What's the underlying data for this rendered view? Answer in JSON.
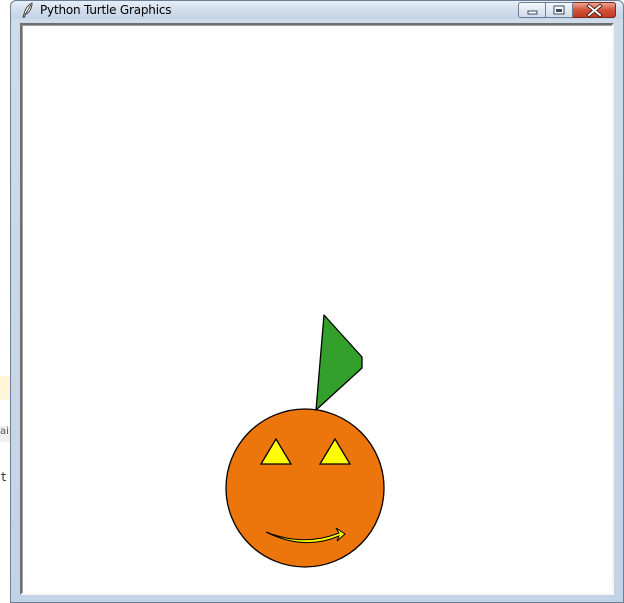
{
  "background_app": {
    "fragments": [
      "",
      "ai",
      "t"
    ]
  },
  "window": {
    "title": "Python Turtle Graphics",
    "controls": {
      "minimize": "minimize-icon",
      "maximize": "restore-icon",
      "close": "close-icon"
    },
    "app_icon": "feather-icon"
  },
  "canvas": {
    "background": "#ffffff",
    "drawing": {
      "pumpkin_color": "#ed760c",
      "stem_color": "#33a02c",
      "features_color": "#ffff00",
      "outline_color": "#000000"
    }
  }
}
